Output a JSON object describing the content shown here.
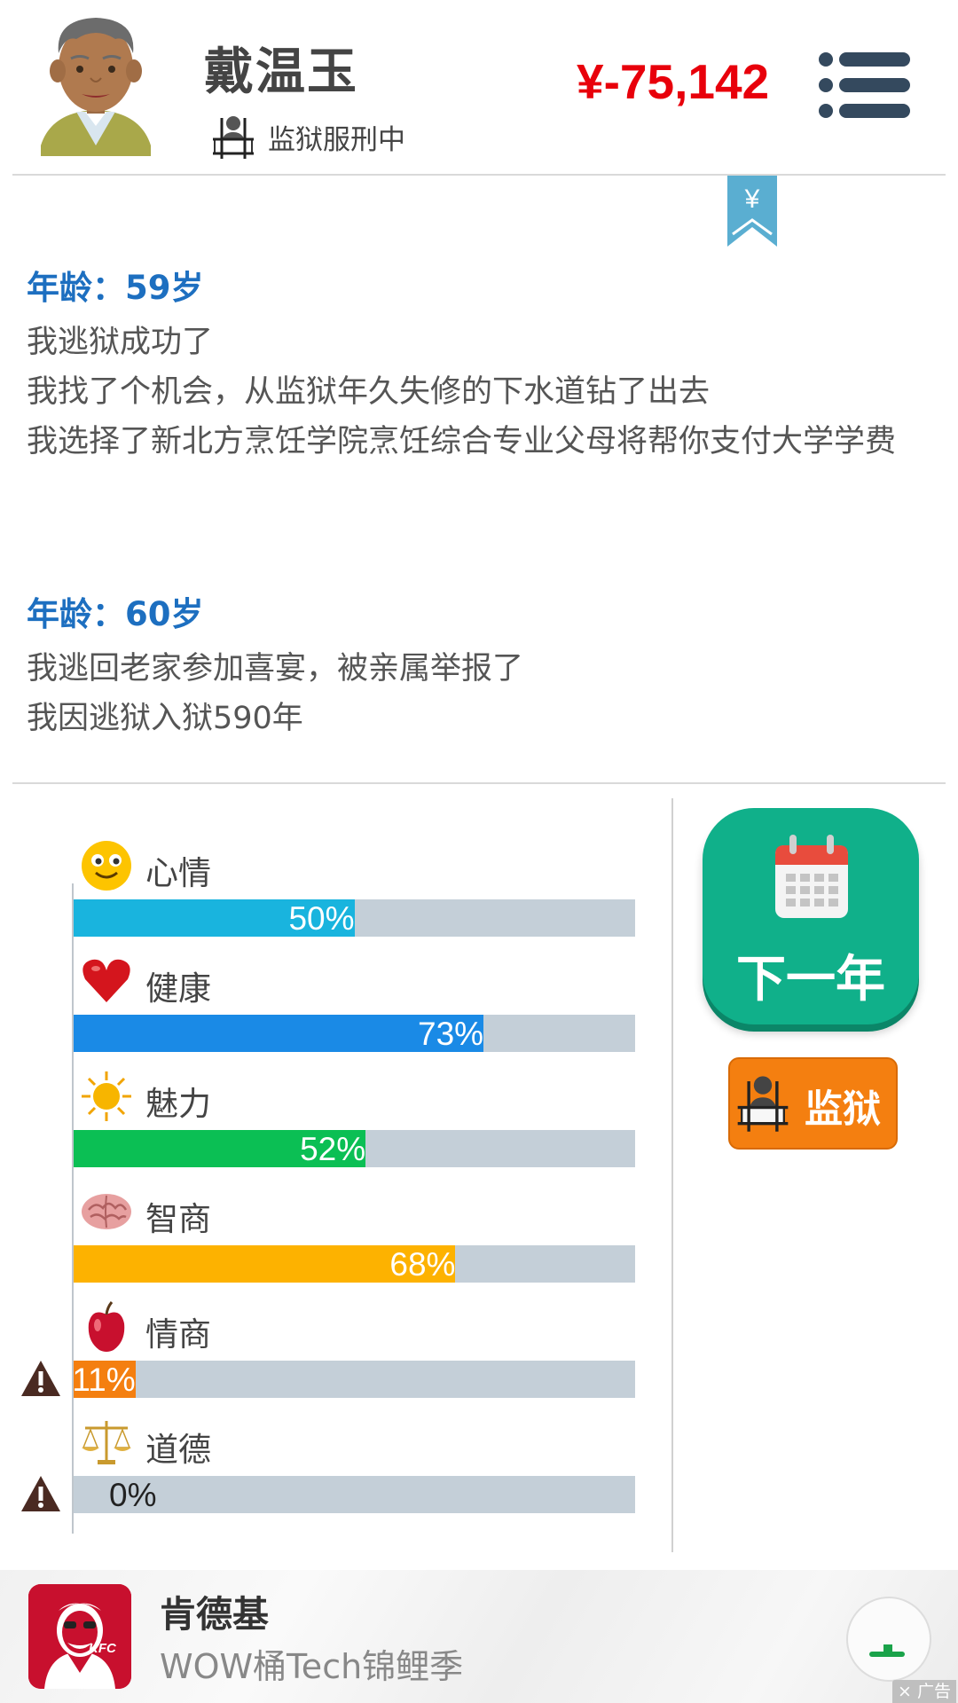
{
  "header": {
    "name": "戴温玉",
    "status": "监狱服刑中",
    "money": "¥-75,142"
  },
  "log": [
    {
      "age": "年龄：59岁",
      "events": [
        "我逃狱成功了",
        "我找了个机会，从监狱年久失修的下水道钻了出去",
        "我选择了新北方烹饪学院烹饪综合专业父母将帮你支付大学学费"
      ]
    },
    {
      "age": "年龄：60岁",
      "events": [
        "我逃回老家参加喜宴，被亲属举报了",
        "我因逃狱入狱590年"
      ]
    }
  ],
  "stats": [
    {
      "label": "心情",
      "value": 50,
      "pct_text": "50%",
      "color": "#19b4de",
      "icon": "smiley-icon",
      "warning": false
    },
    {
      "label": "健康",
      "value": 73,
      "pct_text": "73%",
      "color": "#1a8ae6",
      "icon": "heart-icon",
      "warning": false
    },
    {
      "label": "魅力",
      "value": 52,
      "pct_text": "52%",
      "color": "#0bbf54",
      "icon": "sun-icon",
      "warning": false
    },
    {
      "label": "智商",
      "value": 68,
      "pct_text": "68%",
      "color": "#fdb200",
      "icon": "brain-icon",
      "warning": false
    },
    {
      "label": "情商",
      "value": 11,
      "pct_text": "11%",
      "color": "#f47f10",
      "icon": "apple-icon",
      "warning": true
    },
    {
      "label": "道德",
      "value": 0,
      "pct_text": "0%",
      "color": "#f47f10",
      "icon": "scales-icon",
      "warning": true
    }
  ],
  "actions": {
    "next_year": "下一年",
    "prison": "监狱"
  },
  "ad": {
    "title": "肯德基",
    "subtitle": "WOW桶Tech锦鲤季",
    "logo_text": "KFC",
    "tag": "广告"
  }
}
